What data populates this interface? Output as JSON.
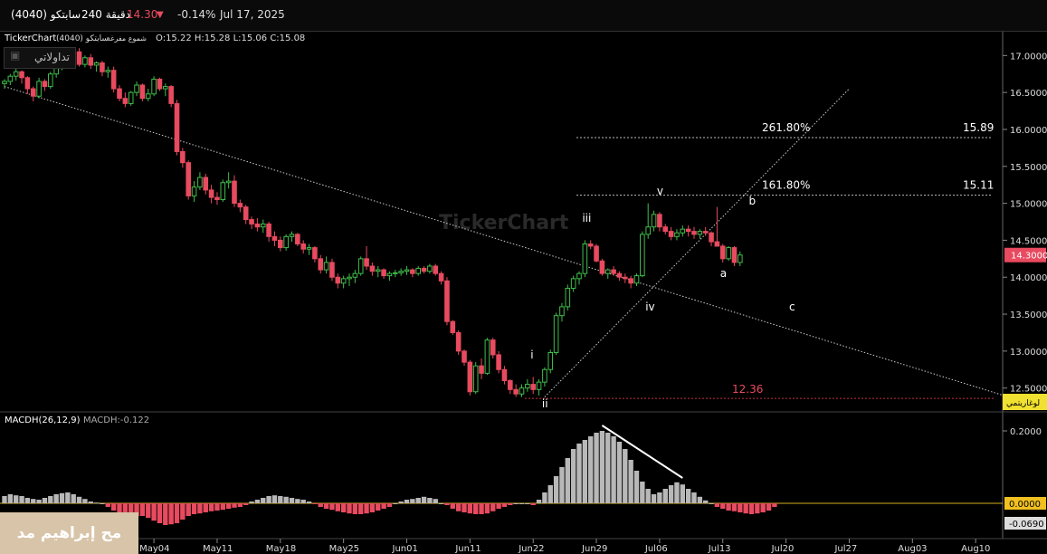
{
  "topbar": {
    "symbol": "سابتكو (4040)",
    "interval": "240 دقيقة",
    "last": "14.30",
    "change_pct": "-0.14%",
    "date": "Jul 17, 2025",
    "down_color": "#e84a5f"
  },
  "legend": {
    "source": "TickerChart",
    "symbol": "سابتكو (4040)",
    "style": "شموع مفرغة",
    "ohlc": "O:15.22  H:15.28  L:15.06  C:15.08"
  },
  "badge": "تداولاتي",
  "watermark": "TickerChart",
  "price_tag": "14.3000",
  "log_button": "لوغاريتمي",
  "macd": {
    "label": "MACDH(26,12,9)",
    "value_label": "MACDH:-0.122",
    "tag_zero": "0.0000",
    "tag_last": "-0.0690"
  },
  "signature": "مح إبراهيم مد",
  "chart_data": {
    "type": "candlestick",
    "price_axis": {
      "ylim": [
        12.3,
        17.2
      ],
      "ticks": [
        "17.0000",
        "16.5000",
        "16.0000",
        "15.5000",
        "15.0000",
        "14.5000",
        "14.0000",
        "13.5000",
        "13.0000",
        "12.5000"
      ]
    },
    "macd_axis": {
      "ylim": [
        -0.06,
        0.21
      ],
      "ticks": [
        "0.2000"
      ]
    },
    "date_ticks": [
      {
        "label": "May04",
        "i": 26
      },
      {
        "label": "May11",
        "i": 37
      },
      {
        "label": "May18",
        "i": 48
      },
      {
        "label": "May25",
        "i": 59
      },
      {
        "label": "Jun01",
        "i": 70
      },
      {
        "label": "Jun11",
        "i": 81
      },
      {
        "label": "Jun22",
        "i": 92
      },
      {
        "label": "Jun29",
        "i": 103
      },
      {
        "label": "Jul06",
        "i": 114
      },
      {
        "label": "Jul13",
        "i": 125
      },
      {
        "label": "Jul20",
        "i": 136
      },
      {
        "label": "Jul27",
        "i": 147
      },
      {
        "label": "Aug03",
        "i": 158
      },
      {
        "label": "Aug10",
        "i": 169
      }
    ],
    "candles": [
      [
        16.62,
        16.68,
        16.55,
        16.65
      ],
      [
        16.65,
        16.75,
        16.6,
        16.72
      ],
      [
        16.72,
        16.82,
        16.66,
        16.78
      ],
      [
        16.78,
        16.8,
        16.62,
        16.7
      ],
      [
        16.7,
        16.72,
        16.48,
        16.55
      ],
      [
        16.55,
        16.58,
        16.38,
        16.45
      ],
      [
        16.45,
        16.7,
        16.42,
        16.65
      ],
      [
        16.65,
        16.68,
        16.52,
        16.58
      ],
      [
        16.58,
        16.78,
        16.55,
        16.75
      ],
      [
        16.75,
        16.88,
        16.7,
        16.85
      ],
      [
        16.85,
        16.98,
        16.8,
        16.95
      ],
      [
        16.95,
        17.02,
        16.9,
        16.98
      ],
      [
        16.98,
        17.08,
        16.92,
        17.05
      ],
      [
        17.05,
        17.1,
        16.85,
        16.88
      ],
      [
        16.88,
        17.0,
        16.84,
        16.97
      ],
      [
        16.97,
        17.02,
        16.82,
        16.87
      ],
      [
        16.87,
        16.92,
        16.78,
        16.9
      ],
      [
        16.9,
        16.93,
        16.72,
        16.78
      ],
      [
        16.78,
        16.85,
        16.7,
        16.8
      ],
      [
        16.8,
        16.85,
        16.5,
        16.55
      ],
      [
        16.55,
        16.6,
        16.38,
        16.42
      ],
      [
        16.42,
        16.5,
        16.3,
        16.35
      ],
      [
        16.35,
        16.52,
        16.32,
        16.5
      ],
      [
        16.5,
        16.65,
        16.45,
        16.6
      ],
      [
        16.6,
        16.62,
        16.38,
        16.42
      ],
      [
        16.42,
        16.55,
        16.38,
        16.48
      ],
      [
        16.48,
        16.72,
        16.45,
        16.68
      ],
      [
        16.68,
        16.7,
        16.52,
        16.55
      ],
      [
        16.55,
        16.62,
        16.45,
        16.58
      ],
      [
        16.58,
        16.6,
        16.3,
        16.35
      ],
      [
        16.35,
        16.4,
        15.65,
        15.7
      ],
      [
        15.7,
        15.75,
        15.48,
        15.55
      ],
      [
        15.55,
        15.58,
        15.05,
        15.1
      ],
      [
        15.1,
        15.3,
        15.02,
        15.22
      ],
      [
        15.22,
        15.42,
        15.18,
        15.35
      ],
      [
        15.35,
        15.4,
        15.12,
        15.18
      ],
      [
        15.18,
        15.25,
        15.0,
        15.08
      ],
      [
        15.08,
        15.15,
        14.98,
        15.05
      ],
      [
        15.05,
        15.32,
        15.02,
        15.28
      ],
      [
        15.28,
        15.42,
        15.2,
        15.3
      ],
      [
        15.3,
        15.38,
        14.95,
        15.0
      ],
      [
        15.0,
        15.05,
        14.88,
        14.95
      ],
      [
        14.95,
        14.98,
        14.72,
        14.78
      ],
      [
        14.78,
        14.82,
        14.65,
        14.72
      ],
      [
        14.72,
        14.8,
        14.62,
        14.68
      ],
      [
        14.68,
        14.78,
        14.6,
        14.72
      ],
      [
        14.72,
        14.75,
        14.48,
        14.55
      ],
      [
        14.55,
        14.62,
        14.42,
        14.5
      ],
      [
        14.5,
        14.55,
        14.35,
        14.4
      ],
      [
        14.4,
        14.58,
        14.36,
        14.55
      ],
      [
        14.55,
        14.62,
        14.48,
        14.58
      ],
      [
        14.58,
        14.6,
        14.42,
        14.45
      ],
      [
        14.45,
        14.5,
        14.32,
        14.38
      ],
      [
        14.38,
        14.45,
        14.3,
        14.4
      ],
      [
        14.4,
        14.42,
        14.2,
        14.25
      ],
      [
        14.25,
        14.3,
        14.05,
        14.1
      ],
      [
        14.1,
        14.28,
        14.05,
        14.2
      ],
      [
        14.2,
        14.25,
        13.95,
        14.0
      ],
      [
        14.0,
        14.05,
        13.85,
        13.92
      ],
      [
        13.92,
        14.02,
        13.85,
        13.98
      ],
      [
        13.98,
        14.05,
        13.88,
        14.0
      ],
      [
        14.0,
        14.1,
        13.92,
        14.05
      ],
      [
        14.05,
        14.28,
        14.02,
        14.25
      ],
      [
        14.25,
        14.42,
        14.1,
        14.15
      ],
      [
        14.15,
        14.2,
        14.02,
        14.08
      ],
      [
        14.08,
        14.15,
        14.0,
        14.1
      ],
      [
        14.1,
        14.12,
        13.98,
        14.02
      ],
      [
        14.02,
        14.08,
        13.95,
        14.05
      ],
      [
        14.05,
        14.1,
        14.0,
        14.06
      ],
      [
        14.06,
        14.12,
        14.02,
        14.08
      ],
      [
        14.08,
        14.15,
        14.03,
        14.1
      ],
      [
        14.1,
        14.12,
        14.0,
        14.05
      ],
      [
        14.05,
        14.15,
        14.02,
        14.12
      ],
      [
        14.12,
        14.15,
        14.05,
        14.08
      ],
      [
        14.08,
        14.18,
        14.05,
        14.15
      ],
      [
        14.15,
        14.18,
        14.02,
        14.05
      ],
      [
        14.05,
        14.08,
        13.9,
        13.95
      ],
      [
        13.95,
        14.0,
        13.35,
        13.4
      ],
      [
        13.4,
        13.42,
        13.22,
        13.25
      ],
      [
        13.25,
        13.28,
        12.95,
        13.0
      ],
      [
        13.0,
        13.02,
        12.8,
        12.85
      ],
      [
        12.85,
        12.88,
        12.4,
        12.45
      ],
      [
        12.45,
        12.85,
        12.42,
        12.8
      ],
      [
        12.8,
        12.9,
        12.62,
        12.7
      ],
      [
        12.7,
        13.18,
        12.68,
        13.15
      ],
      [
        13.15,
        13.18,
        12.9,
        12.95
      ],
      [
        12.95,
        13.0,
        12.7,
        12.75
      ],
      [
        12.75,
        12.8,
        12.55,
        12.6
      ],
      [
        12.6,
        12.62,
        12.42,
        12.48
      ],
      [
        12.48,
        12.55,
        12.38,
        12.42
      ],
      [
        12.42,
        12.55,
        12.38,
        12.5
      ],
      [
        12.5,
        12.62,
        12.45,
        12.55
      ],
      [
        12.55,
        12.65,
        12.42,
        12.48
      ],
      [
        12.48,
        12.62,
        12.4,
        12.58
      ],
      [
        12.58,
        12.78,
        12.52,
        12.75
      ],
      [
        12.75,
        13.02,
        12.7,
        12.98
      ],
      [
        12.98,
        13.52,
        12.95,
        13.48
      ],
      [
        13.48,
        13.65,
        13.4,
        13.6
      ],
      [
        13.6,
        13.9,
        13.55,
        13.85
      ],
      [
        13.85,
        14.02,
        13.8,
        13.98
      ],
      [
        13.98,
        14.08,
        13.9,
        14.05
      ],
      [
        14.05,
        14.5,
        14.0,
        14.45
      ],
      [
        14.45,
        14.5,
        14.38,
        14.42
      ],
      [
        14.42,
        14.45,
        14.2,
        14.22
      ],
      [
        14.22,
        14.25,
        14.02,
        14.05
      ],
      [
        14.05,
        14.12,
        13.98,
        14.1
      ],
      [
        14.1,
        14.15,
        14.02,
        14.05
      ],
      [
        14.05,
        14.08,
        13.95,
        14.0
      ],
      [
        14.0,
        14.05,
        13.92,
        13.98
      ],
      [
        13.98,
        14.02,
        13.85,
        13.92
      ],
      [
        13.92,
        14.05,
        13.88,
        14.02
      ],
      [
        14.02,
        14.62,
        14.0,
        14.58
      ],
      [
        14.58,
        15.0,
        14.52,
        14.68
      ],
      [
        14.68,
        14.9,
        14.62,
        14.85
      ],
      [
        14.85,
        14.88,
        14.62,
        14.68
      ],
      [
        14.68,
        14.72,
        14.58,
        14.62
      ],
      [
        14.62,
        14.68,
        14.5,
        14.55
      ],
      [
        14.55,
        14.65,
        14.5,
        14.6
      ],
      [
        14.6,
        14.7,
        14.55,
        14.65
      ],
      [
        14.65,
        14.7,
        14.55,
        14.62
      ],
      [
        14.62,
        14.68,
        14.52,
        14.58
      ],
      [
        14.58,
        14.65,
        14.52,
        14.62
      ],
      [
        14.62,
        14.68,
        14.56,
        14.6
      ],
      [
        14.6,
        14.62,
        14.42,
        14.48
      ],
      [
        14.48,
        14.95,
        14.45,
        14.42
      ],
      [
        14.42,
        14.45,
        14.2,
        14.25
      ],
      [
        14.25,
        14.42,
        14.22,
        14.4
      ],
      [
        14.4,
        14.42,
        14.15,
        14.2
      ],
      [
        14.2,
        14.35,
        14.15,
        14.3
      ]
    ],
    "macdh": [
      0.02,
      0.025,
      0.022,
      0.02,
      0.015,
      0.012,
      0.01,
      0.015,
      0.02,
      0.025,
      0.028,
      0.03,
      0.025,
      0.018,
      0.012,
      0.005,
      0.002,
      0.0,
      -0.01,
      -0.02,
      -0.025,
      -0.028,
      -0.03,
      -0.035,
      -0.035,
      -0.04,
      -0.048,
      -0.055,
      -0.06,
      -0.058,
      -0.055,
      -0.045,
      -0.035,
      -0.03,
      -0.028,
      -0.025,
      -0.022,
      -0.02,
      -0.018,
      -0.015,
      -0.012,
      -0.01,
      -0.005,
      0.005,
      0.01,
      0.015,
      0.02,
      0.022,
      0.02,
      0.018,
      0.015,
      0.012,
      0.01,
      0.005,
      -0.002,
      -0.01,
      -0.015,
      -0.018,
      -0.022,
      -0.025,
      -0.028,
      -0.03,
      -0.03,
      -0.028,
      -0.025,
      -0.02,
      -0.015,
      -0.01,
      0.0,
      0.005,
      0.01,
      0.012,
      0.015,
      0.018,
      0.015,
      0.012,
      0.0,
      -0.005,
      -0.015,
      -0.022,
      -0.025,
      -0.028,
      -0.03,
      -0.03,
      -0.028,
      -0.022,
      -0.015,
      -0.01,
      -0.005,
      0.0,
      0.0,
      0.0,
      -0.005,
      0.01,
      0.03,
      0.05,
      0.075,
      0.1,
      0.125,
      0.15,
      0.165,
      0.175,
      0.185,
      0.195,
      0.2,
      0.195,
      0.185,
      0.17,
      0.15,
      0.12,
      0.09,
      0.06,
      0.04,
      0.025,
      0.03,
      0.04,
      0.05,
      0.058,
      0.052,
      0.04,
      0.03,
      0.018,
      0.008,
      0.0,
      -0.01,
      -0.015,
      -0.02,
      -0.022,
      -0.025,
      -0.028,
      -0.03,
      -0.028,
      -0.025,
      -0.02,
      -0.01
    ],
    "trendlines": [
      {
        "name": "descending",
        "from": {
          "i": 0,
          "v": 16.58
        },
        "to": {
          "i": 178,
          "v": 12.3
        }
      },
      {
        "name": "ascending",
        "from": {
          "i": 94,
          "v": 12.38
        },
        "to": {
          "i": 147,
          "v": 16.55
        }
      }
    ],
    "fib_levels": [
      {
        "pct": "261.80%",
        "value": "15.89",
        "v": 15.89
      },
      {
        "pct": "161.80%",
        "value": "15.11",
        "v": 15.11
      }
    ],
    "low_level": {
      "value": "12.36",
      "v": 12.36
    },
    "wave_labels": [
      {
        "t": "iii",
        "i": 101,
        "v": 14.75
      },
      {
        "t": "v",
        "i": 114,
        "v": 15.12
      },
      {
        "t": "i",
        "i": 92,
        "v": 12.9
      },
      {
        "t": "ii",
        "i": 94,
        "v": 12.24
      },
      {
        "t": "iv",
        "i": 112,
        "v": 13.55
      },
      {
        "t": "a",
        "i": 125,
        "v": 14.0
      },
      {
        "t": "b",
        "i": 130,
        "v": 14.98
      },
      {
        "t": "c",
        "i": 137,
        "v": 13.55
      }
    ],
    "macd_divergence": {
      "from": {
        "i": 104,
        "v": 0.215
      },
      "to": {
        "i": 118,
        "v": 0.07
      }
    }
  }
}
